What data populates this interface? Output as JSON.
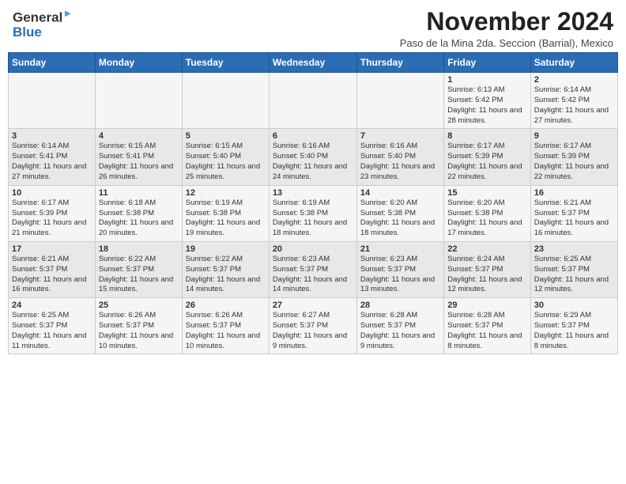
{
  "header": {
    "logo_line1": "General",
    "logo_line2": "Blue",
    "title": "November 2024",
    "subtitle": "Paso de la Mina 2da. Seccion (Barrial), Mexico"
  },
  "calendar": {
    "weekdays": [
      "Sunday",
      "Monday",
      "Tuesday",
      "Wednesday",
      "Thursday",
      "Friday",
      "Saturday"
    ],
    "weeks": [
      [
        {
          "day": "",
          "info": ""
        },
        {
          "day": "",
          "info": ""
        },
        {
          "day": "",
          "info": ""
        },
        {
          "day": "",
          "info": ""
        },
        {
          "day": "",
          "info": ""
        },
        {
          "day": "1",
          "info": "Sunrise: 6:13 AM\nSunset: 5:42 PM\nDaylight: 11 hours and 28 minutes."
        },
        {
          "day": "2",
          "info": "Sunrise: 6:14 AM\nSunset: 5:42 PM\nDaylight: 11 hours and 27 minutes."
        }
      ],
      [
        {
          "day": "3",
          "info": "Sunrise: 6:14 AM\nSunset: 5:41 PM\nDaylight: 11 hours and 27 minutes."
        },
        {
          "day": "4",
          "info": "Sunrise: 6:15 AM\nSunset: 5:41 PM\nDaylight: 11 hours and 26 minutes."
        },
        {
          "day": "5",
          "info": "Sunrise: 6:15 AM\nSunset: 5:40 PM\nDaylight: 11 hours and 25 minutes."
        },
        {
          "day": "6",
          "info": "Sunrise: 6:16 AM\nSunset: 5:40 PM\nDaylight: 11 hours and 24 minutes."
        },
        {
          "day": "7",
          "info": "Sunrise: 6:16 AM\nSunset: 5:40 PM\nDaylight: 11 hours and 23 minutes."
        },
        {
          "day": "8",
          "info": "Sunrise: 6:17 AM\nSunset: 5:39 PM\nDaylight: 11 hours and 22 minutes."
        },
        {
          "day": "9",
          "info": "Sunrise: 6:17 AM\nSunset: 5:39 PM\nDaylight: 11 hours and 22 minutes."
        }
      ],
      [
        {
          "day": "10",
          "info": "Sunrise: 6:17 AM\nSunset: 5:39 PM\nDaylight: 11 hours and 21 minutes."
        },
        {
          "day": "11",
          "info": "Sunrise: 6:18 AM\nSunset: 5:38 PM\nDaylight: 11 hours and 20 minutes."
        },
        {
          "day": "12",
          "info": "Sunrise: 6:19 AM\nSunset: 5:38 PM\nDaylight: 11 hours and 19 minutes."
        },
        {
          "day": "13",
          "info": "Sunrise: 6:19 AM\nSunset: 5:38 PM\nDaylight: 11 hours and 18 minutes."
        },
        {
          "day": "14",
          "info": "Sunrise: 6:20 AM\nSunset: 5:38 PM\nDaylight: 11 hours and 18 minutes."
        },
        {
          "day": "15",
          "info": "Sunrise: 6:20 AM\nSunset: 5:38 PM\nDaylight: 11 hours and 17 minutes."
        },
        {
          "day": "16",
          "info": "Sunrise: 6:21 AM\nSunset: 5:37 PM\nDaylight: 11 hours and 16 minutes."
        }
      ],
      [
        {
          "day": "17",
          "info": "Sunrise: 6:21 AM\nSunset: 5:37 PM\nDaylight: 11 hours and 16 minutes."
        },
        {
          "day": "18",
          "info": "Sunrise: 6:22 AM\nSunset: 5:37 PM\nDaylight: 11 hours and 15 minutes."
        },
        {
          "day": "19",
          "info": "Sunrise: 6:22 AM\nSunset: 5:37 PM\nDaylight: 11 hours and 14 minutes."
        },
        {
          "day": "20",
          "info": "Sunrise: 6:23 AM\nSunset: 5:37 PM\nDaylight: 11 hours and 14 minutes."
        },
        {
          "day": "21",
          "info": "Sunrise: 6:23 AM\nSunset: 5:37 PM\nDaylight: 11 hours and 13 minutes."
        },
        {
          "day": "22",
          "info": "Sunrise: 6:24 AM\nSunset: 5:37 PM\nDaylight: 11 hours and 12 minutes."
        },
        {
          "day": "23",
          "info": "Sunrise: 6:25 AM\nSunset: 5:37 PM\nDaylight: 11 hours and 12 minutes."
        }
      ],
      [
        {
          "day": "24",
          "info": "Sunrise: 6:25 AM\nSunset: 5:37 PM\nDaylight: 11 hours and 11 minutes."
        },
        {
          "day": "25",
          "info": "Sunrise: 6:26 AM\nSunset: 5:37 PM\nDaylight: 11 hours and 10 minutes."
        },
        {
          "day": "26",
          "info": "Sunrise: 6:26 AM\nSunset: 5:37 PM\nDaylight: 11 hours and 10 minutes."
        },
        {
          "day": "27",
          "info": "Sunrise: 6:27 AM\nSunset: 5:37 PM\nDaylight: 11 hours and 9 minutes."
        },
        {
          "day": "28",
          "info": "Sunrise: 6:28 AM\nSunset: 5:37 PM\nDaylight: 11 hours and 9 minutes."
        },
        {
          "day": "29",
          "info": "Sunrise: 6:28 AM\nSunset: 5:37 PM\nDaylight: 11 hours and 8 minutes."
        },
        {
          "day": "30",
          "info": "Sunrise: 6:29 AM\nSunset: 5:37 PM\nDaylight: 11 hours and 8 minutes."
        }
      ]
    ]
  }
}
